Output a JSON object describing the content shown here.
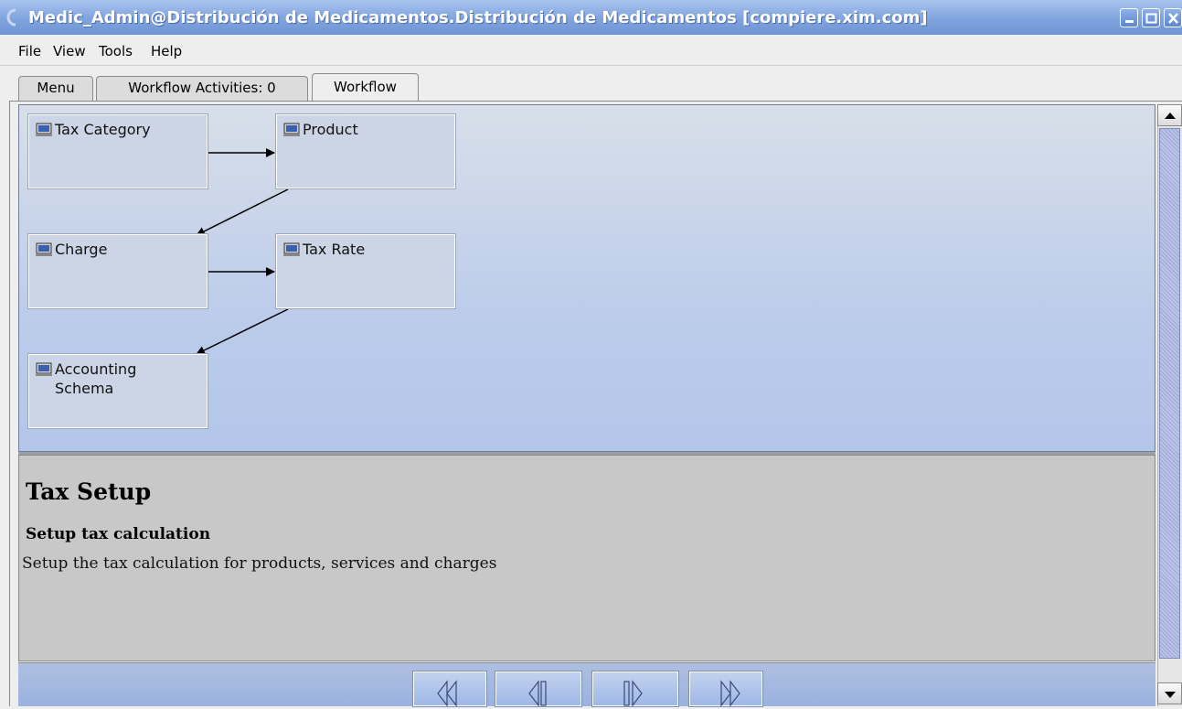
{
  "window": {
    "title": "Medic_Admin@Distribución de Medicamentos.Distribución de Medicamentos [compiere.xim.com]",
    "buttons": [
      "minimize-icon",
      "maximize-icon",
      "close-icon"
    ]
  },
  "menubar": {
    "items": [
      {
        "label": "File"
      },
      {
        "label": "View"
      },
      {
        "label": "Tools"
      },
      {
        "label": "Help"
      }
    ]
  },
  "tabs": [
    {
      "label": "Menu"
    },
    {
      "label": "Workflow Activities: 0"
    },
    {
      "label": "Workflow",
      "selected": true
    }
  ],
  "workflow": {
    "nodes": [
      {
        "label": "Tax Category",
        "icon": "window-icon"
      },
      {
        "label": "Product",
        "icon": "window-icon"
      },
      {
        "label": "Charge",
        "icon": "window-icon"
      },
      {
        "label": "Tax Rate",
        "icon": "window-icon"
      },
      {
        "label": "Accounting Schema",
        "icon": "window-icon"
      }
    ],
    "transitions": [
      {
        "from": "Tax Category",
        "to": "Product"
      },
      {
        "from": "Product",
        "to": "Charge"
      },
      {
        "from": "Charge",
        "to": "Tax Rate"
      },
      {
        "from": "Tax Rate",
        "to": "Accounting Schema"
      }
    ]
  },
  "description": {
    "title": "Tax Setup",
    "subtitle": "Setup tax calculation",
    "help": "Setup the tax calculation for products, services and charges"
  },
  "navigation": {
    "buttons": [
      "first-icon",
      "previous-icon",
      "next-icon",
      "last-icon"
    ]
  },
  "colors": {
    "titlebar": "#7fa3de",
    "workflow_background": "#bcccea",
    "node_fill": "#ccd5e5",
    "description_background": "#c8c8c8"
  }
}
